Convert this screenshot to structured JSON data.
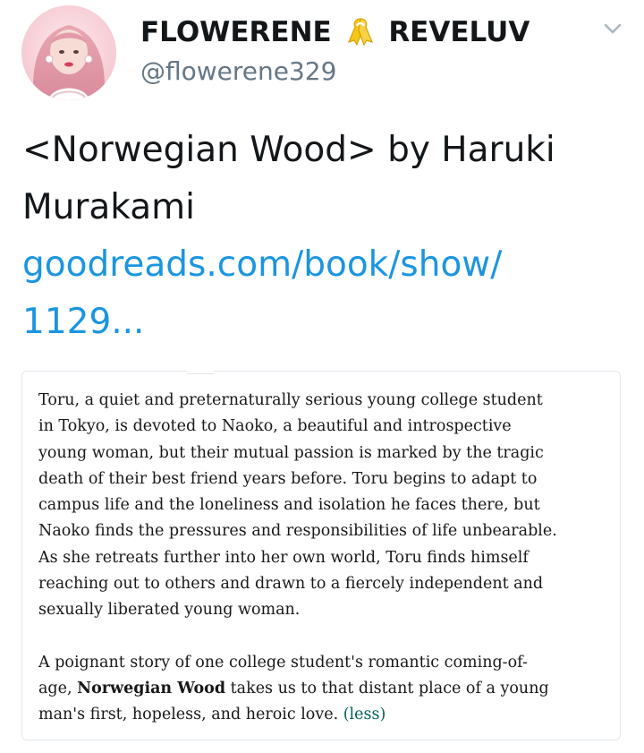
{
  "tweet": {
    "display_name_part1": "FLOWERENE",
    "display_name_part2": "REVELUV",
    "ribbon_emoji": "yellow-ribbon",
    "handle": "@flowerene329",
    "text_line1": "<Norwegian Wood> by Haruki",
    "text_line2": "Murakami",
    "link_line1": "goodreads.com/book/show/",
    "link_line2": "1129...",
    "link_color": "#1b95e0"
  },
  "card": {
    "para1_lines": [
      "Toru, a quiet and preternaturally serious young college student",
      "in Tokyo, is devoted to Naoko, a beautiful and introspective",
      "young woman, but their mutual passion is marked by the tragic",
      "death of their best friend years before. Toru begins to adapt to",
      "campus life and the loneliness and isolation he faces there, but",
      "Naoko finds the pressures and responsibilities of life unbearable.",
      "As she retreats further into her own world, Toru finds himself",
      "reaching out to others and drawn to a fiercely independent and",
      "sexually liberated young woman."
    ],
    "para2_line1": "A poignant story of one college student's romantic coming-of-",
    "para2_line2_pre": "age, ",
    "para2_line2_bold": "Norwegian Wood",
    "para2_line2_post": " takes us to that distant place of a young",
    "para2_line3": "man's first, hopeless, and heroic love. ",
    "less_label": "(less)"
  }
}
